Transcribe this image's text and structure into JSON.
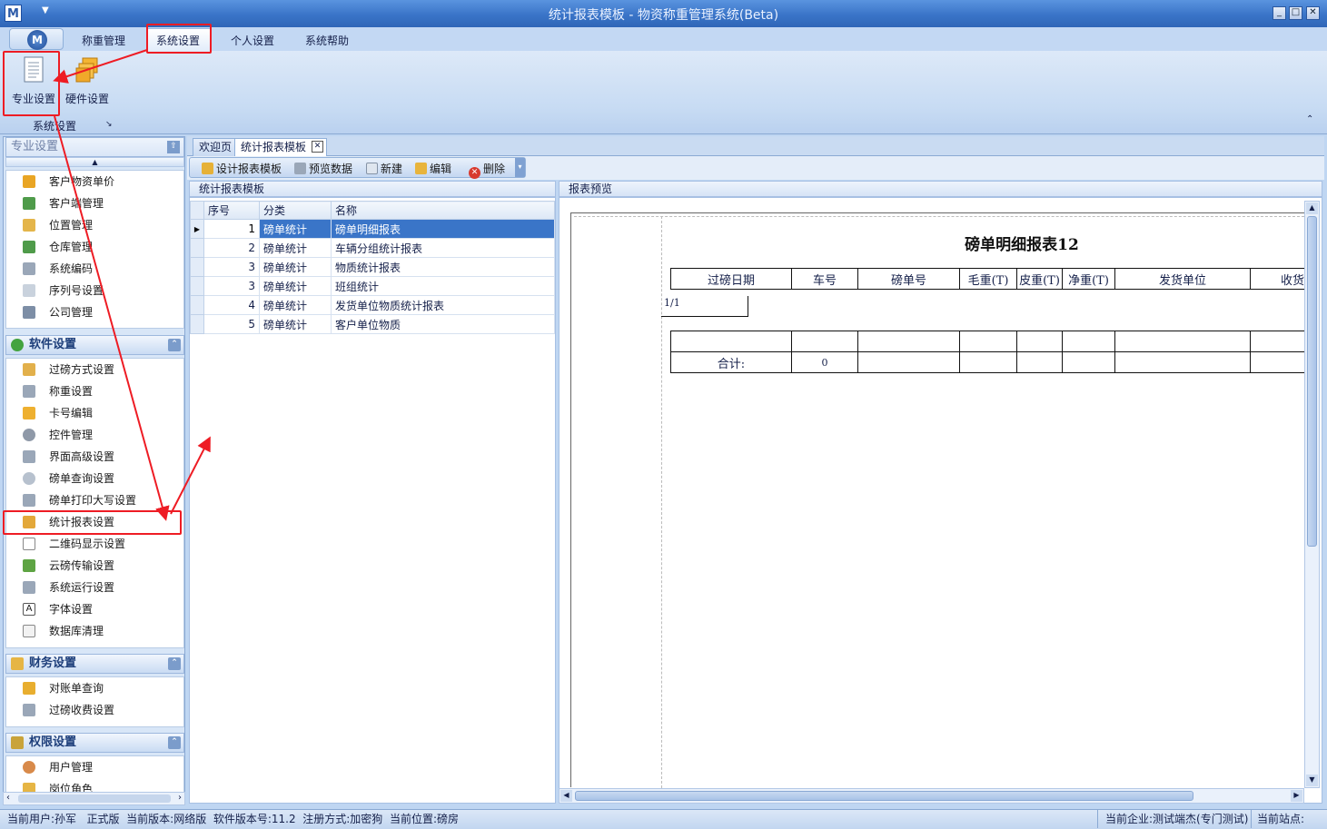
{
  "window": {
    "logo": "M",
    "title": "统计报表模板 - 物资称重管理系统(Beta)"
  },
  "ribbon": {
    "orb": "M",
    "tabs": [
      {
        "label": "称重管理"
      },
      {
        "label": "系统设置"
      },
      {
        "label": "个人设置"
      },
      {
        "label": "系统帮助"
      }
    ],
    "active_tab": "系统设置",
    "buttons": [
      {
        "label": "专业设置",
        "icon": "document-list-icon"
      },
      {
        "label": "硬件设置",
        "icon": "stacked-boxes-icon"
      }
    ],
    "group_label": "系统设置"
  },
  "nav": {
    "top_header": "专业设置",
    "top_items": [
      {
        "label": "客户物资单价"
      },
      {
        "label": "客户端管理"
      },
      {
        "label": "位置管理"
      },
      {
        "label": "仓库管理"
      },
      {
        "label": "系统编码"
      },
      {
        "label": "序列号设置"
      },
      {
        "label": "公司管理"
      }
    ],
    "software_header": "软件设置",
    "software_items": [
      {
        "label": "过磅方式设置"
      },
      {
        "label": "称重设置"
      },
      {
        "label": "卡号编辑"
      },
      {
        "label": "控件管理"
      },
      {
        "label": "界面高级设置"
      },
      {
        "label": "磅单查询设置"
      },
      {
        "label": "磅单打印大写设置"
      },
      {
        "label": "统计报表设置"
      },
      {
        "label": "二维码显示设置"
      },
      {
        "label": "云磅传输设置"
      },
      {
        "label": "系统运行设置"
      },
      {
        "label": "字体设置"
      },
      {
        "label": "数据库清理"
      }
    ],
    "finance_header": "财务设置",
    "finance_items": [
      {
        "label": "对账单查询"
      },
      {
        "label": "过磅收费设置"
      }
    ],
    "permission_header": "权限设置",
    "permission_items": [
      {
        "label": "用户管理"
      },
      {
        "label": "岗位角色"
      }
    ]
  },
  "doc_tabs": [
    {
      "label": "欢迎页"
    },
    {
      "label": "统计报表模板"
    }
  ],
  "toolbar": {
    "design": "设计报表模板",
    "preview": "预览数据",
    "new": "新建",
    "edit": "编辑",
    "delete": "删除"
  },
  "template_panel": {
    "title": "统计报表模板",
    "columns": [
      "序号",
      "分类",
      "名称"
    ],
    "rows": [
      {
        "no": "1",
        "category": "磅单统计",
        "name": "磅单明细报表"
      },
      {
        "no": "2",
        "category": "磅单统计",
        "name": "车辆分组统计报表"
      },
      {
        "no": "3",
        "category": "磅单统计",
        "name": "物质统计报表"
      },
      {
        "no": "3",
        "category": "磅单统计",
        "name": "班组统计"
      },
      {
        "no": "4",
        "category": "磅单统计",
        "name": "发货单位物质统计报表"
      },
      {
        "no": "5",
        "category": "磅单统计",
        "name": "客户单位物质"
      }
    ]
  },
  "preview_panel": {
    "title": "报表预览",
    "report_title": "磅单明细报表12",
    "columns": [
      "过磅日期",
      "车号",
      "磅单号",
      "毛重(T)",
      "皮重(T)",
      "净重(T)",
      "发货单位",
      "收货"
    ],
    "page_number": "1/1",
    "total_label": "合计:",
    "total_value": "0"
  },
  "status": {
    "user": "当前用户:孙军",
    "edition": "正式版",
    "version_type": "当前版本:网络版",
    "software_version": "软件版本号:11.2",
    "register": "注册方式:加密狗",
    "location": "当前位置:磅房",
    "company": "当前企业:测试端杰(专门测试)",
    "site": "当前站点:"
  },
  "colors": {
    "annotation": "#ee1c24",
    "selection": "#3a75c8"
  }
}
